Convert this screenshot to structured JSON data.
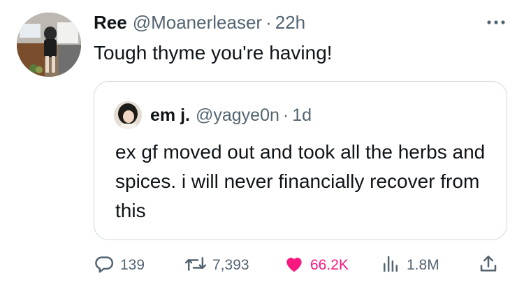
{
  "tweet": {
    "display_name": "Ree",
    "handle": "@Moanerleaser",
    "separator": "·",
    "time": "22h",
    "text": "Tough thyme you're having!"
  },
  "quoted_tweet": {
    "display_name": "em j.",
    "handle": "@yagye0n",
    "separator": "·",
    "time": "1d",
    "text": "ex gf moved out and took all the herbs and spices. i will never financially recover from this"
  },
  "actions": {
    "replies": "139",
    "retweets": "7,393",
    "likes": "66.2K",
    "views": "1.8M"
  },
  "colors": {
    "like_active": "#f91880",
    "secondary_text": "#536471",
    "border": "#cfd9de"
  },
  "icons": [
    "more-horizontal-icon",
    "reply-icon",
    "retweet-icon",
    "heart-icon",
    "views-icon",
    "share-icon"
  ]
}
